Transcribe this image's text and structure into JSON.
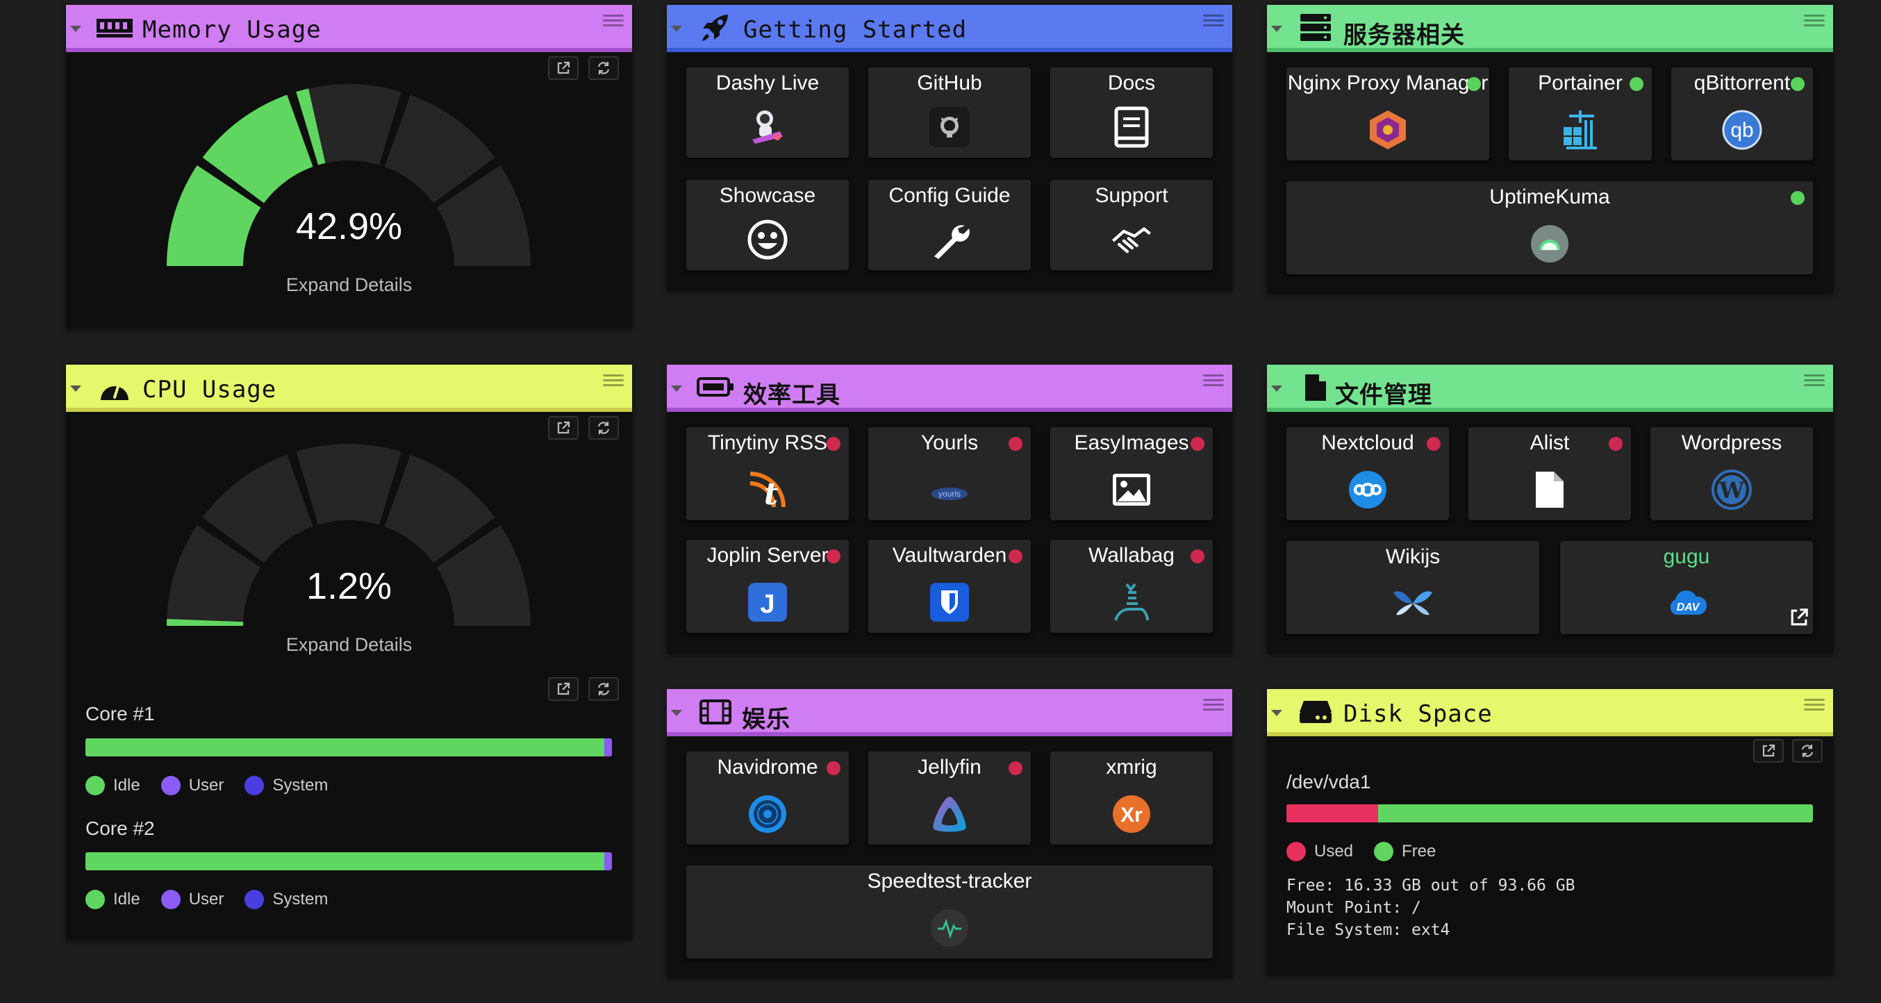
{
  "memory": {
    "title": "Memory Usage",
    "value": "42.9%",
    "percent": 42.9,
    "expand": "Expand Details"
  },
  "cpu": {
    "title": "CPU Usage",
    "value": "1.2%",
    "percent": 1.2,
    "expand": "Expand Details",
    "cores": [
      {
        "label": "Core #1",
        "idle_percent": 98.5
      },
      {
        "label": "Core #2",
        "idle_percent": 98.5
      }
    ],
    "legend": [
      "Idle",
      "User",
      "System"
    ]
  },
  "getting_started": {
    "title": "Getting Started",
    "items": [
      {
        "label": "Dashy Live"
      },
      {
        "label": "GitHub"
      },
      {
        "label": "Docs"
      },
      {
        "label": "Showcase"
      },
      {
        "label": "Config Guide"
      },
      {
        "label": "Support"
      }
    ]
  },
  "server": {
    "title": "服务器相关",
    "items": [
      {
        "label": "Nginx Proxy Manager",
        "status": "online"
      },
      {
        "label": "Portainer",
        "status": "online"
      },
      {
        "label": "qBittorrent",
        "status": "online"
      },
      {
        "label": "UptimeKuma",
        "status": "online"
      }
    ]
  },
  "tools": {
    "title": "效率工具",
    "items": [
      {
        "label": "Tinytiny RSS",
        "status": "offline"
      },
      {
        "label": "Yourls",
        "status": "offline"
      },
      {
        "label": "EasyImages",
        "status": "offline"
      },
      {
        "label": "Joplin Server",
        "status": "offline"
      },
      {
        "label": "Vaultwarden",
        "status": "offline"
      },
      {
        "label": "Wallabag",
        "status": "offline"
      }
    ]
  },
  "files": {
    "title": "文件管理",
    "items": [
      {
        "label": "Nextcloud",
        "status": "offline"
      },
      {
        "label": "Alist",
        "status": "offline"
      },
      {
        "label": "Wordpress"
      },
      {
        "label": "Wikijs"
      },
      {
        "label": "gugu"
      }
    ]
  },
  "fun": {
    "title": "娱乐",
    "items": [
      {
        "label": "Navidrome",
        "status": "offline"
      },
      {
        "label": "Jellyfin",
        "status": "offline"
      },
      {
        "label": "xmrig"
      },
      {
        "label": "Speedtest-tracker"
      }
    ]
  },
  "disk": {
    "title": "Disk Space",
    "device": "/dev/vda1",
    "used_percent": 17.4,
    "legend": [
      "Used",
      "Free"
    ],
    "free_line": "Free: 16.33 GB out of 93.66 GB",
    "mount_line": "Mount Point: /",
    "fs_line": "File System: ext4"
  },
  "icons": {
    "yourls_text": "yourls",
    "qbittorrent_text": "qb",
    "nextcloud_text": "ooo",
    "wordpress_text": "W",
    "tinytiny_text": "t",
    "joplin_text": "J",
    "xmrig_text": "Xr",
    "gugu_text": "DAV"
  },
  "colors": {
    "purple": "#d07cf3",
    "blue": "#5b79f1",
    "green": "#74e38f",
    "yellow": "#e6f76b",
    "online": "#5ad35a",
    "offline": "#d0294f",
    "gauge_fill": "#60d660"
  }
}
